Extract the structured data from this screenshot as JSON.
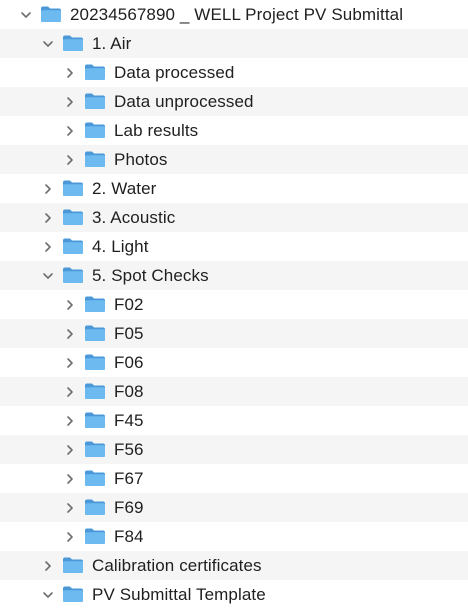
{
  "colors": {
    "folder_body": "#5aa9e6",
    "folder_tab": "#4a98d8",
    "folder_front": "#6cbaf0",
    "chevron": "#6e6e6e",
    "stripe": "#f5f5f5",
    "text": "#1f1f1f"
  },
  "icons": {
    "folder": "folder-icon",
    "expanded": "chevron-down-icon",
    "collapsed": "chevron-right-icon"
  },
  "tree": {
    "rows": [
      {
        "label": "20234567890 _ WELL Project PV Submittal",
        "expanded": true
      },
      {
        "label": "1. Air",
        "expanded": true
      },
      {
        "label": "Data processed",
        "expanded": false
      },
      {
        "label": "Data unprocessed",
        "expanded": false
      },
      {
        "label": "Lab results",
        "expanded": false
      },
      {
        "label": "Photos",
        "expanded": false
      },
      {
        "label": "2. Water",
        "expanded": false
      },
      {
        "label": "3. Acoustic",
        "expanded": false
      },
      {
        "label": "4. Light",
        "expanded": false
      },
      {
        "label": "5.  Spot Checks",
        "expanded": true
      },
      {
        "label": "F02",
        "expanded": false
      },
      {
        "label": "F05",
        "expanded": false
      },
      {
        "label": "F06",
        "expanded": false
      },
      {
        "label": "F08",
        "expanded": false
      },
      {
        "label": "F45",
        "expanded": false
      },
      {
        "label": "F56",
        "expanded": false
      },
      {
        "label": "F67",
        "expanded": false
      },
      {
        "label": "F69",
        "expanded": false
      },
      {
        "label": "F84",
        "expanded": false
      },
      {
        "label": "Calibration certificates",
        "expanded": false
      },
      {
        "label": "PV Submittal Template",
        "expanded": true
      }
    ]
  }
}
